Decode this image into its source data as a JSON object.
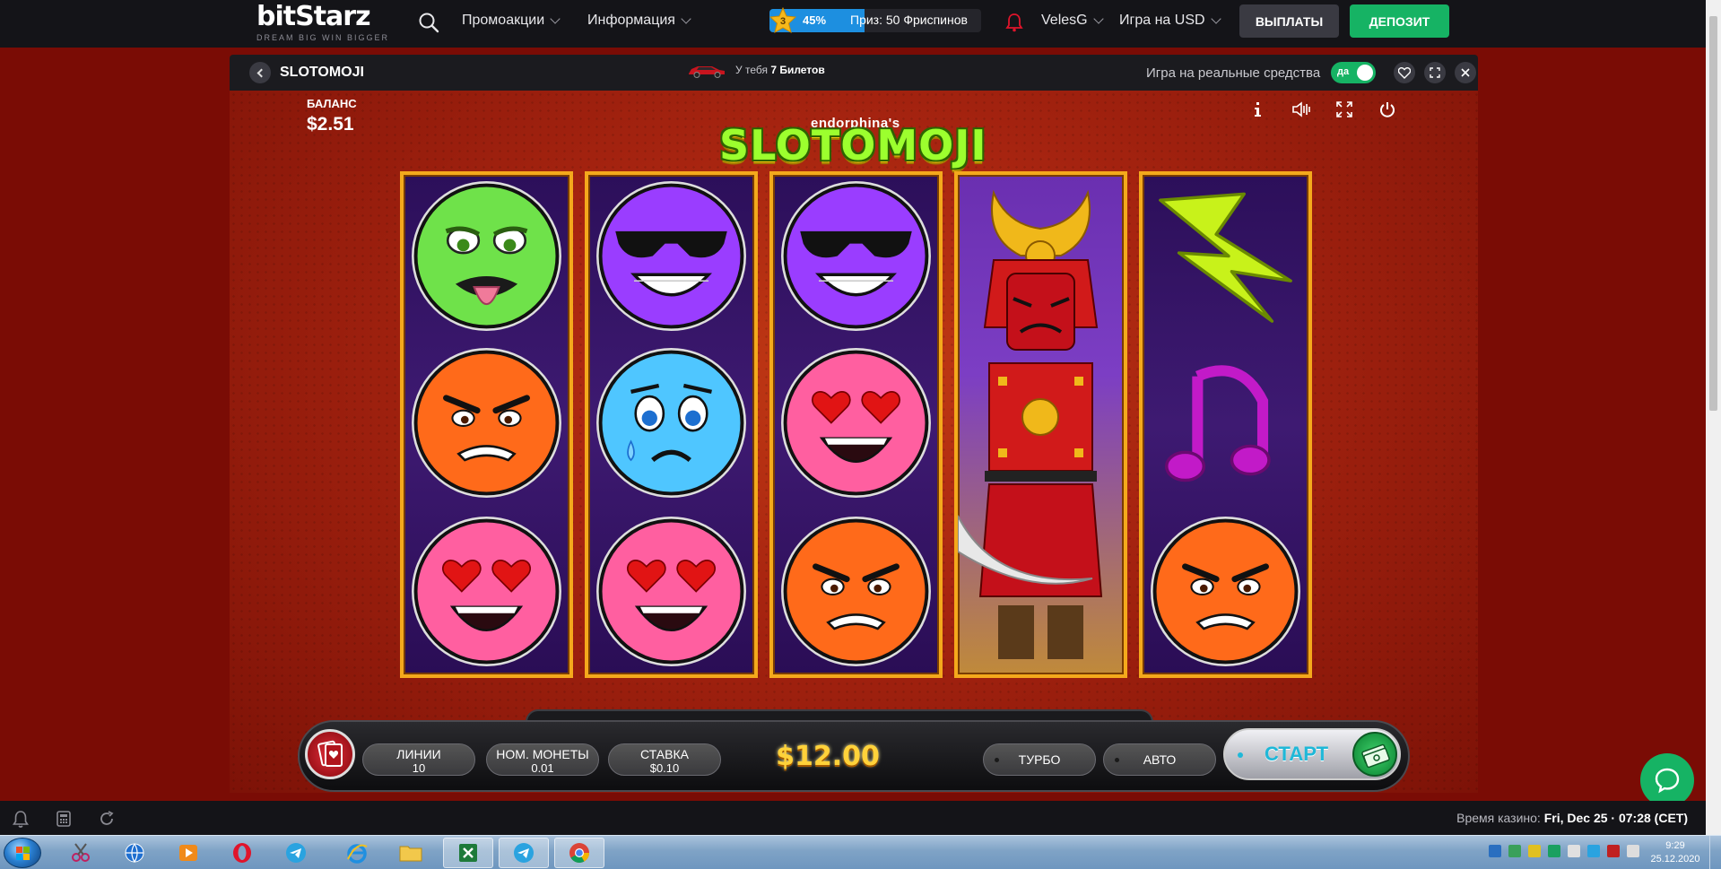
{
  "topnav": {
    "logo_wordmark": "bitStarz",
    "logo_tagline": "DREAM BIG  WIN BIGGER",
    "promotions": "Промоакции",
    "information": "Информация",
    "progress": {
      "level": "3",
      "percent_text": "45%",
      "fraction": 0.45,
      "prize": "Приз: 50 Фриспинов"
    },
    "username": "VelesG",
    "currency": "Игра на USD",
    "payouts_button": "ВЫПЛАТЫ",
    "deposit_button": "ДЕПОЗИТ"
  },
  "game_header": {
    "title": "SLOTOMOJI",
    "tickets_prefix": "У тебя",
    "tickets_count": "7 Билетов",
    "real_money_label": "Игра на реальные средства",
    "toggle_label": "да"
  },
  "game": {
    "balance_label": "БАЛАНС",
    "balance_value": "$2.51",
    "brand_sub": "endorphina's",
    "brand_title": "SLOTOMOJI",
    "reels": [
      [
        "sick-green-face",
        "angry-orange-face",
        "heart-eyes-pink-face"
      ],
      [
        "cool-purple-face",
        "sad-blue-face",
        "heart-eyes-pink-face"
      ],
      [
        "cool-purple-face",
        "heart-eyes-pink-face",
        "angry-orange-face"
      ],
      [
        "samurai-wild"
      ],
      [
        "lightning-bolt",
        "music-note",
        "angry-orange-face"
      ]
    ],
    "controls": {
      "lines_label": "ЛИНИИ",
      "lines_value": "10",
      "coin_label": "НОМ. МОНЕТЫ",
      "coin_value": "0.01",
      "bet_label": "СТАВКА",
      "bet_value": "$0.10",
      "total_bet": "$12.00",
      "turbo": "ТУРБО",
      "auto": "АВТО",
      "start": "СТАРТ"
    }
  },
  "footer": {
    "casino_time_label": "Время казино:",
    "casino_time_value": "Fri, Dec 25 · 07:28 (CET)"
  },
  "taskbar": {
    "time": "9:29",
    "date": "25.12.2020"
  },
  "colors": {
    "accent_green": "#16b364",
    "nav_bg": "#141418",
    "reel_border": "#f4a91c",
    "bet_gold": "#ffd23a"
  }
}
